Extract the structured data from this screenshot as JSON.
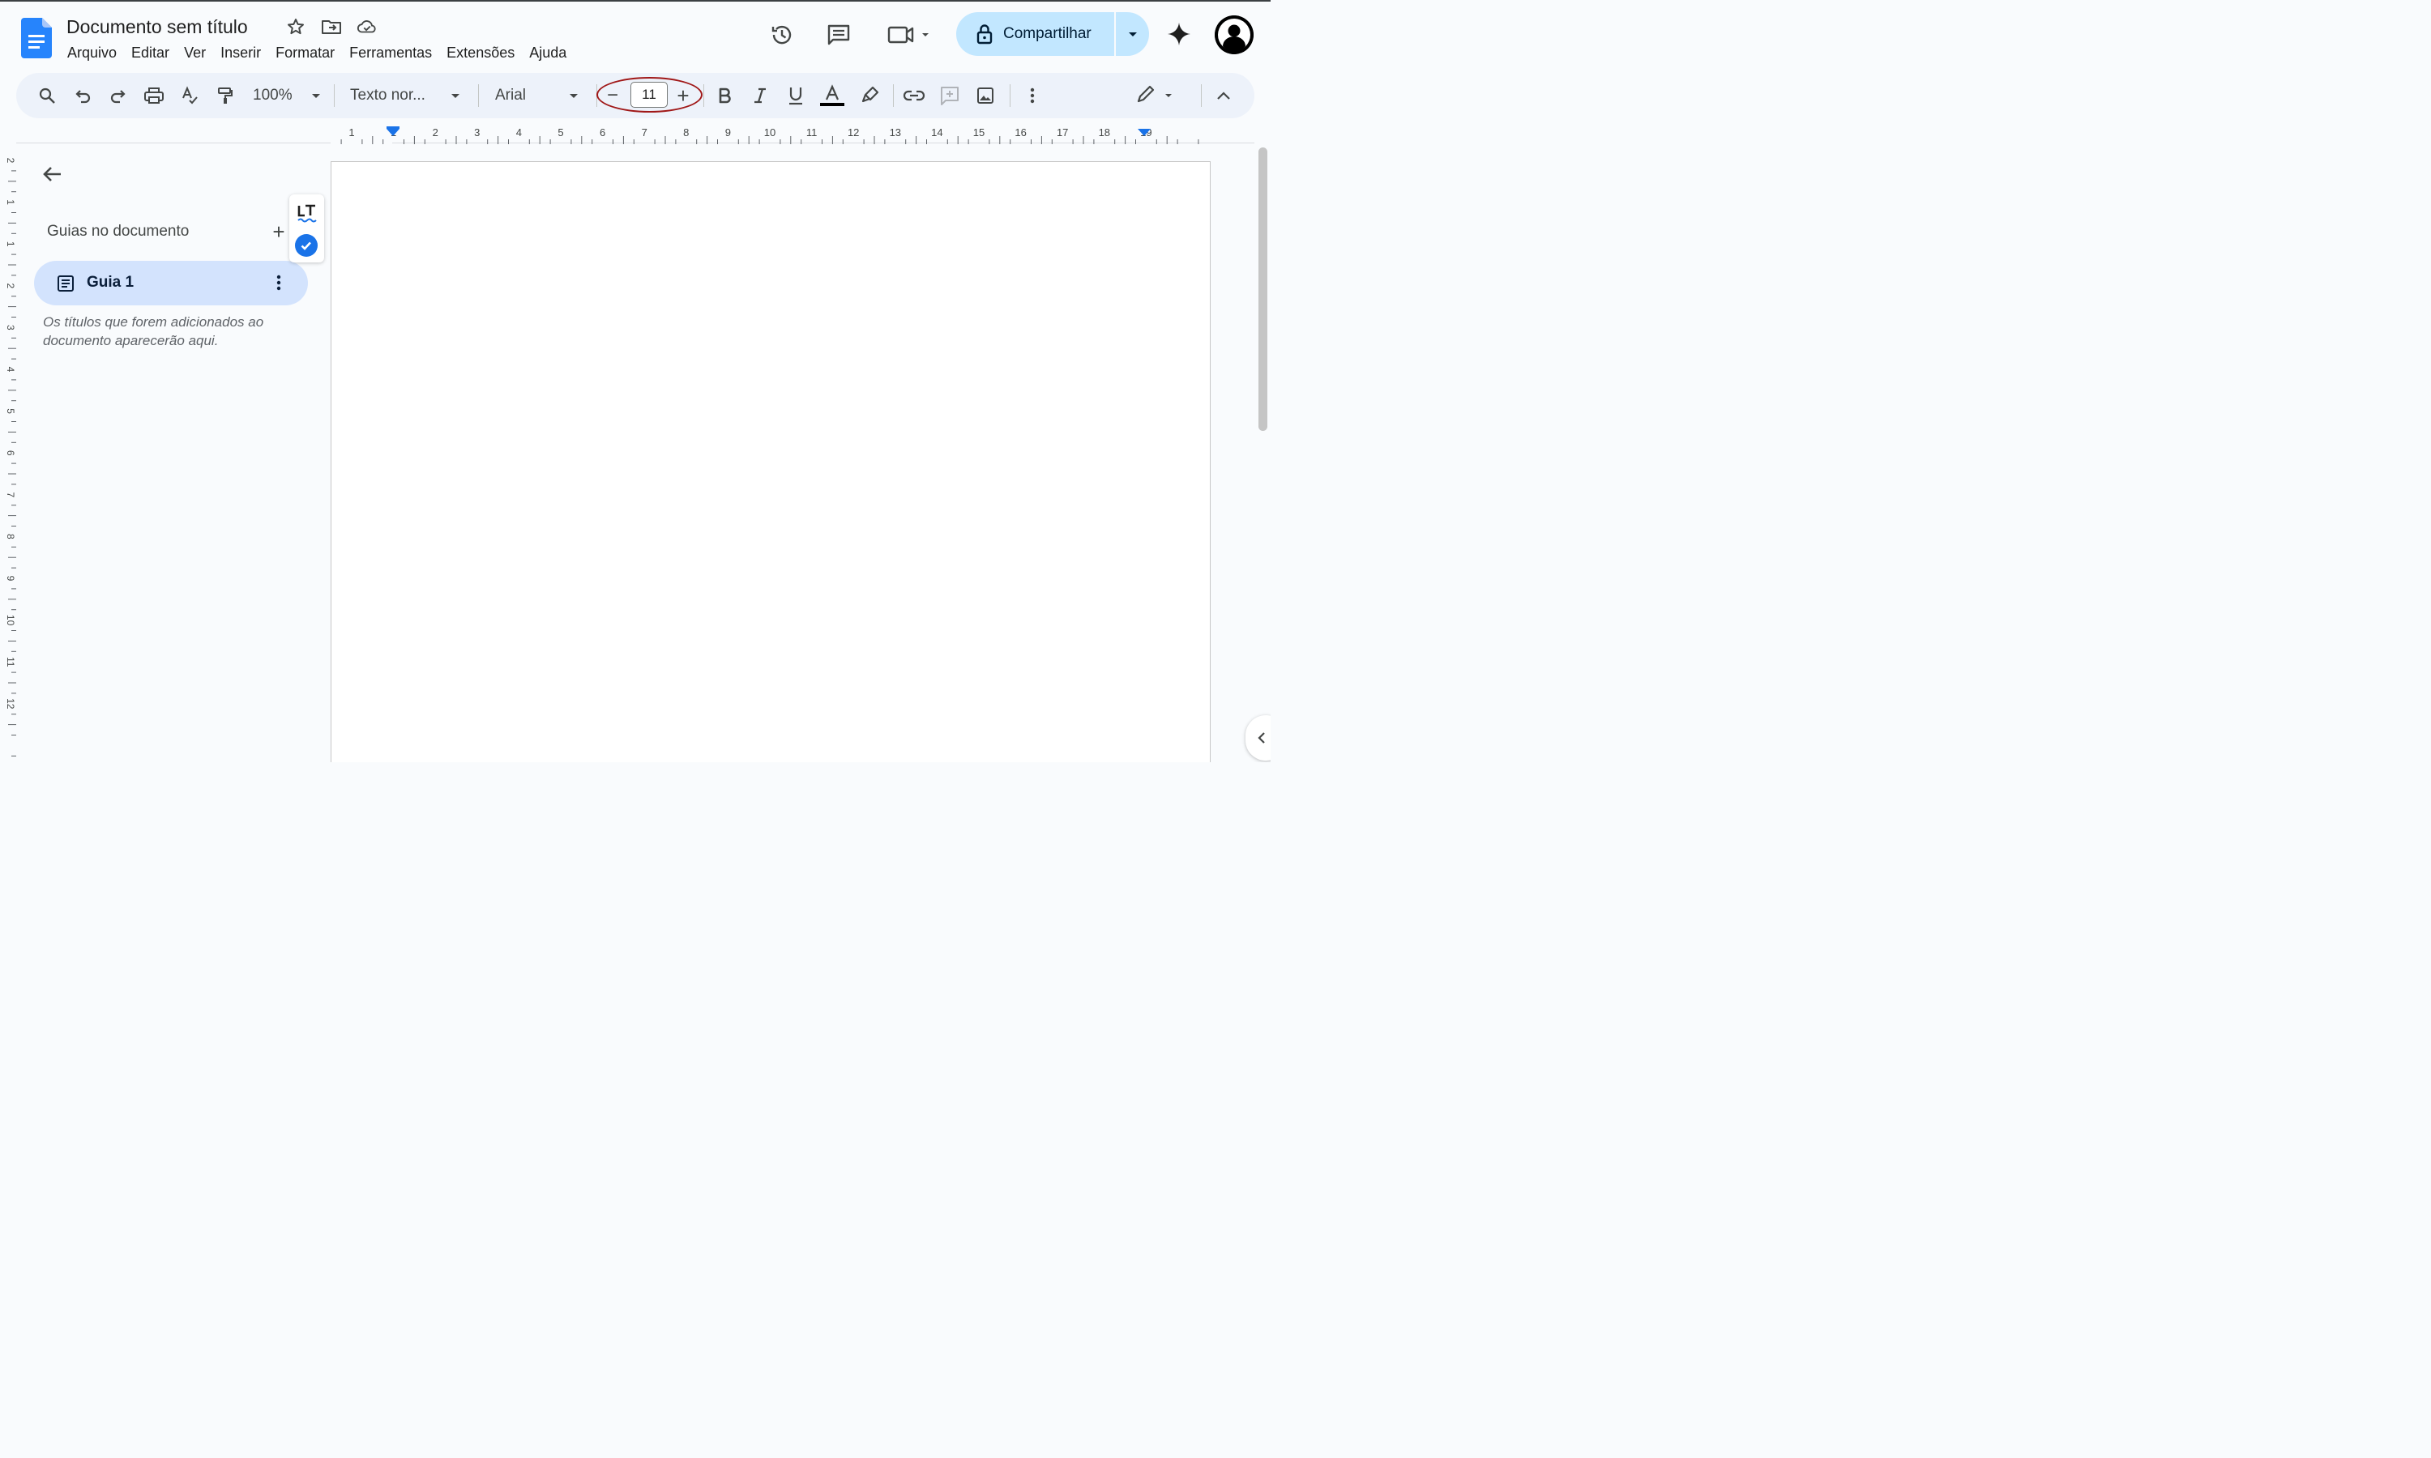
{
  "document": {
    "title": "Documento sem título"
  },
  "menu": [
    "Arquivo",
    "Editar",
    "Ver",
    "Inserir",
    "Formatar",
    "Ferramentas",
    "Extensões",
    "Ajuda"
  ],
  "header": {
    "share_label": "Compartilhar"
  },
  "toolbar": {
    "zoom": "100%",
    "paragraph_style": "Texto nor...",
    "font": "Arial",
    "font_size": "11",
    "decrease_size_label": "−",
    "increase_size_label": "+"
  },
  "ruler": {
    "horizontal_labels": [
      "1",
      "1",
      "2",
      "3",
      "4",
      "5",
      "6",
      "7",
      "8",
      "9",
      "10",
      "11",
      "12",
      "13",
      "14",
      "15",
      "16",
      "17",
      "18",
      "19"
    ],
    "vertical_labels": [
      "2",
      "1",
      "1",
      "2",
      "3",
      "4",
      "5",
      "6",
      "7",
      "8",
      "9",
      "10",
      "11",
      "12"
    ]
  },
  "sidebar": {
    "outline_title": "Guias no documento",
    "add_label": "+",
    "tabs": [
      {
        "label": "Guia 1"
      }
    ],
    "hint": "Os títulos que forem adicionados ao documento aparecerão aqui."
  },
  "colors": {
    "accent": "#1a73e8",
    "share_bg": "#c2e7ff",
    "toolbar_bg": "#edf2fa",
    "tab_active_bg": "#d3e3fd",
    "highlight_oval": "#a01818"
  }
}
